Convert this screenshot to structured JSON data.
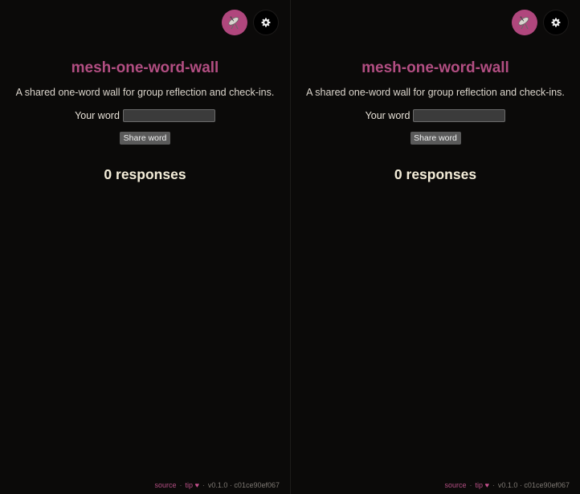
{
  "panes": [
    {
      "title": "mesh-one-word-wall",
      "description": "A shared one-word wall for group reflection and check-ins.",
      "word_label": "Your word",
      "word_value": "",
      "share_label": "Share word",
      "responses": "0 responses",
      "footer": {
        "source": "source",
        "sep": "·",
        "tip": "tip",
        "heart": "♥",
        "version": "v0.1.0 · c01ce90ef067"
      }
    },
    {
      "title": "mesh-one-word-wall",
      "description": "A shared one-word wall for group reflection and check-ins.",
      "word_label": "Your word",
      "word_value": "",
      "share_label": "Share word",
      "responses": "0 responses",
      "footer": {
        "source": "source",
        "sep": "·",
        "tip": "tip",
        "heart": "♥",
        "version": "v0.1.0 · c01ce90ef067"
      }
    }
  ],
  "icons": {
    "sync": "satellite-antenna-icon",
    "settings": "gear-icon"
  },
  "colors": {
    "accent": "#b0477d",
    "title": "#b24e82",
    "background": "#0b0a09",
    "responses": "#f4edd9"
  }
}
